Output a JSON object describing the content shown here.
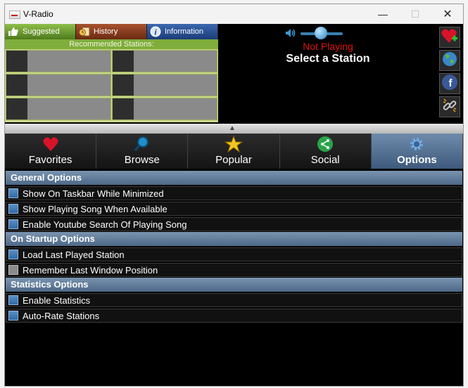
{
  "window": {
    "title": "V-Radio",
    "minimize": "—",
    "maximize": "☐",
    "close": "✕"
  },
  "tabs": [
    {
      "label": "Suggested",
      "icon": "thumbs-up-icon"
    },
    {
      "label": "History",
      "icon": "history-icon"
    },
    {
      "label": "Information",
      "icon": "info-icon"
    }
  ],
  "recommended": {
    "header": "Recommended Stations:",
    "count": 6
  },
  "player": {
    "status": "Not Playing",
    "station": "Select a Station",
    "volume": 0.5
  },
  "side_buttons": [
    "add-favorite-icon",
    "globe-icon",
    "facebook-icon",
    "link-icon"
  ],
  "nav": [
    {
      "label": "Favorites",
      "icon": "heart-icon"
    },
    {
      "label": "Browse",
      "icon": "magnifier-icon"
    },
    {
      "label": "Popular",
      "icon": "star-icon"
    },
    {
      "label": "Social",
      "icon": "share-icon"
    },
    {
      "label": "Options",
      "icon": "gear-icon",
      "active": true
    }
  ],
  "options": {
    "general": {
      "title": "General Options",
      "items": [
        {
          "label": "Show On Taskbar While Minimized",
          "checked": true
        },
        {
          "label": "Show Playing Song When Available",
          "checked": true
        },
        {
          "label": "Enable Youtube Search Of Playing Song",
          "checked": true
        }
      ]
    },
    "startup": {
      "title": "On Startup Options",
      "items": [
        {
          "label": "Load Last Played Station",
          "checked": true
        },
        {
          "label": "Remember Last Window Position",
          "checked": false
        }
      ]
    },
    "statistics": {
      "title": "Statistics Options",
      "items": [
        {
          "label": "Enable Statistics",
          "checked": true
        },
        {
          "label": "Auto-Rate Stations",
          "checked": true
        }
      ]
    }
  }
}
